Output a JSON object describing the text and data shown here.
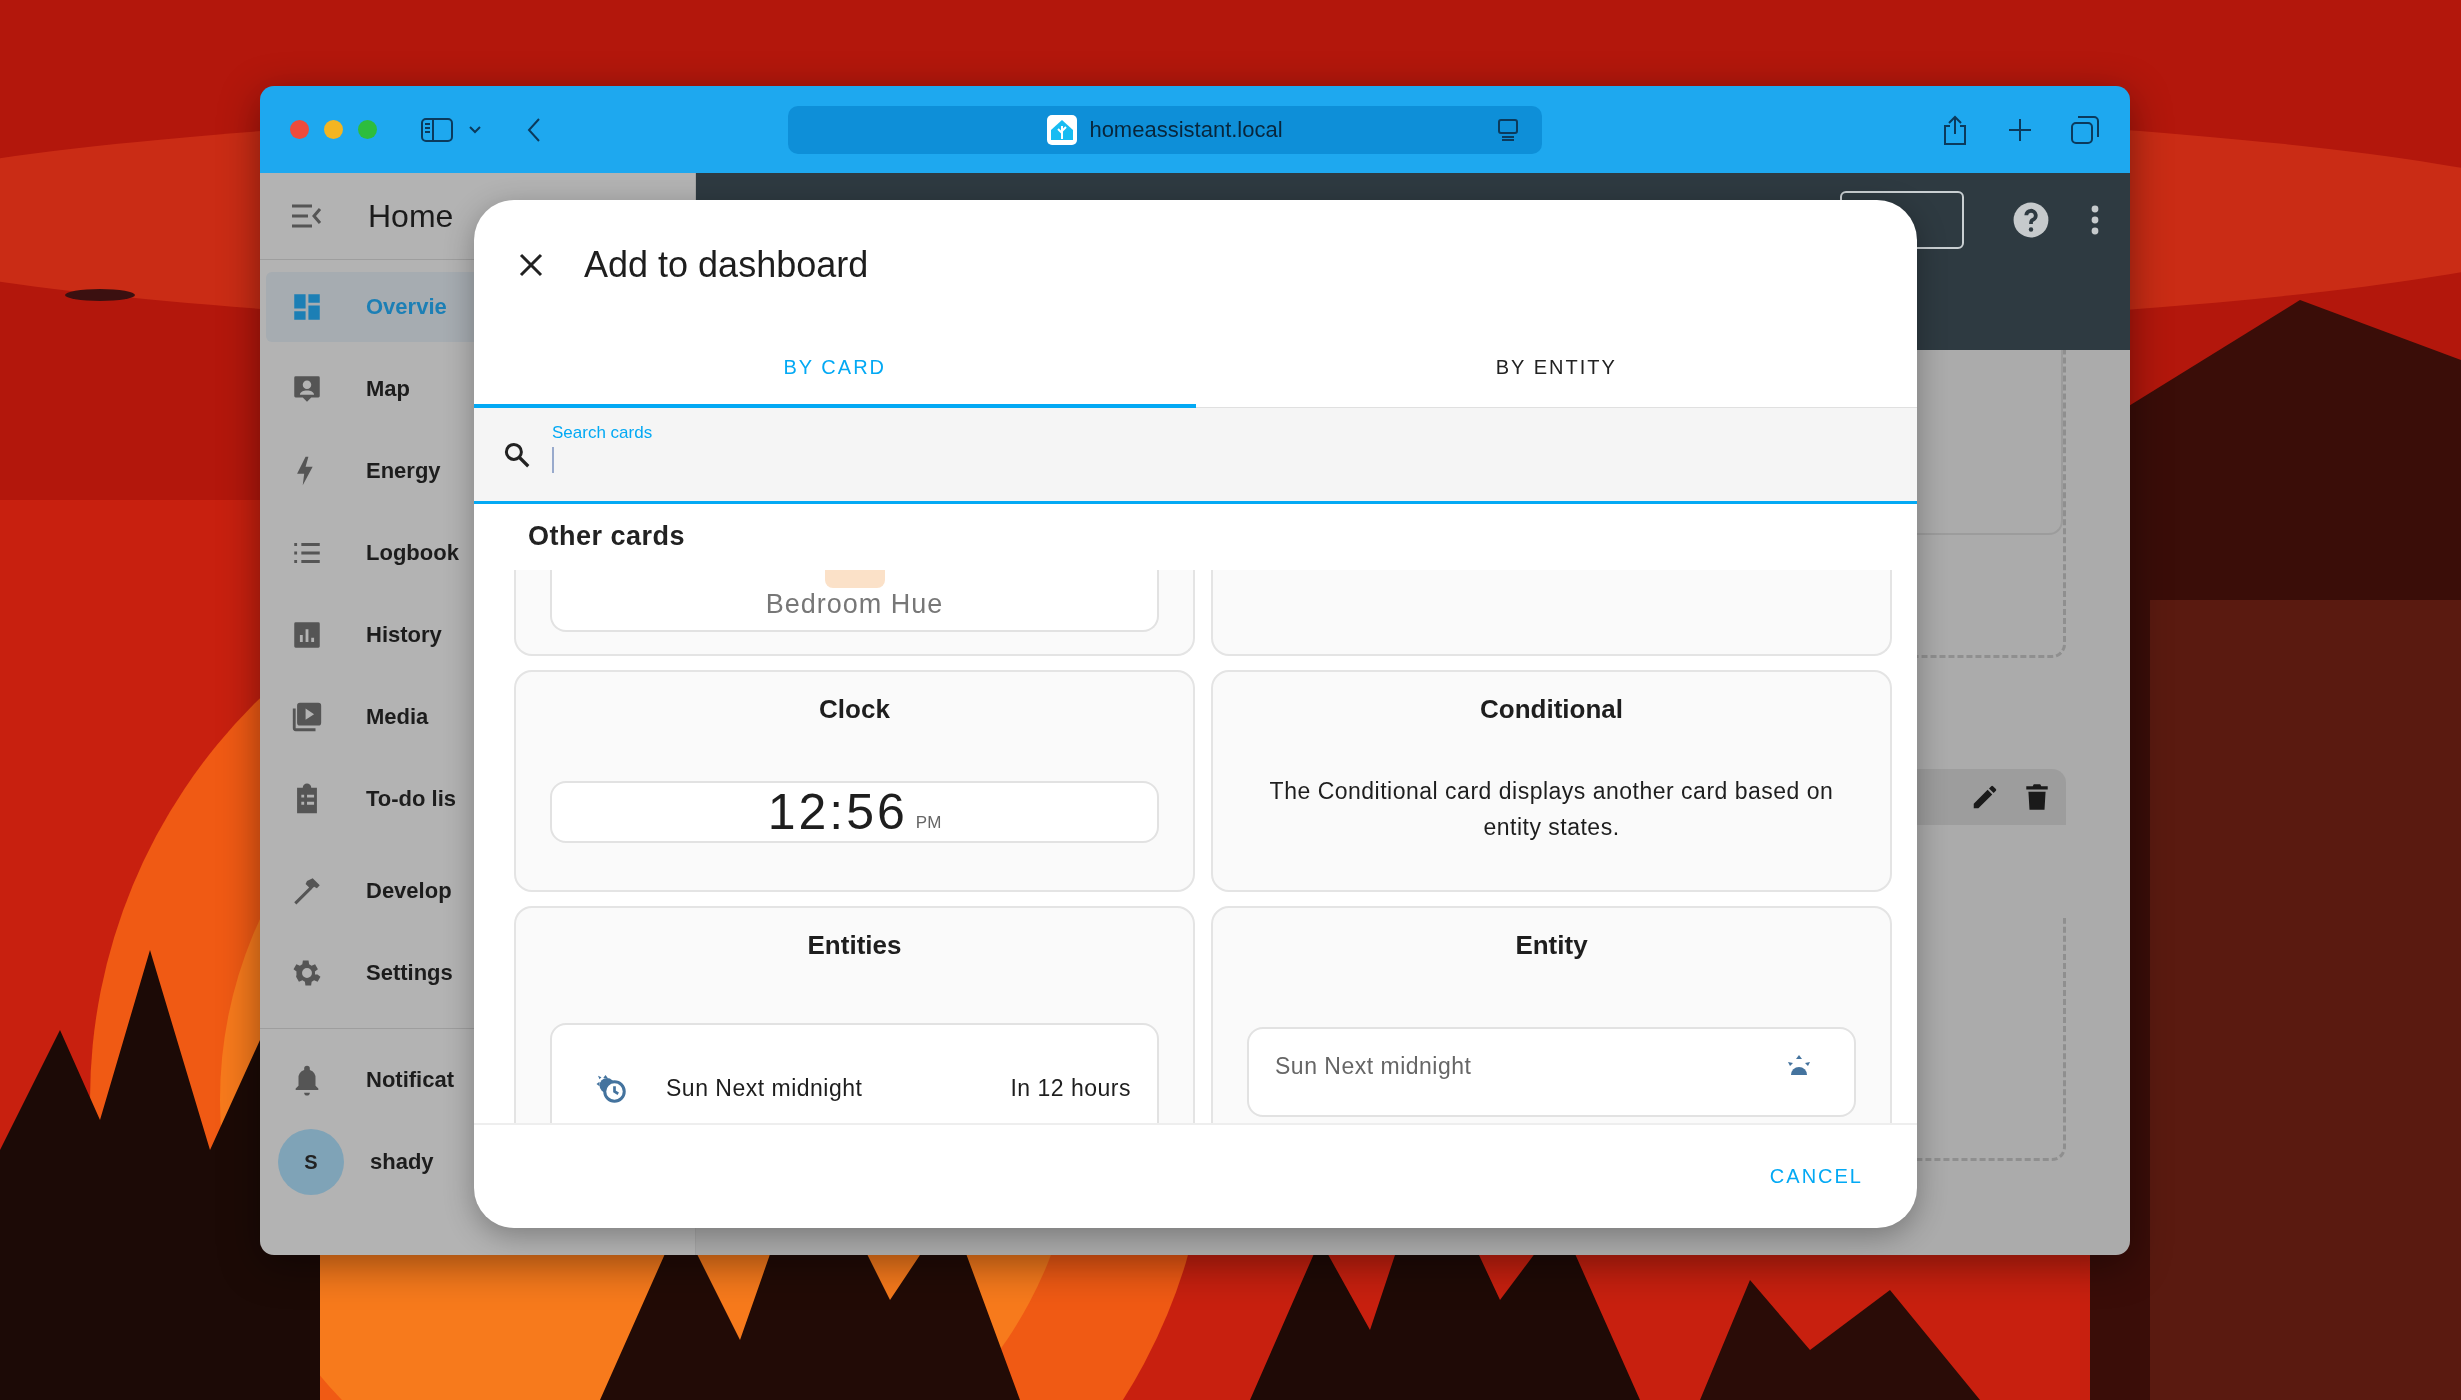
{
  "browser": {
    "url": "homeassistant.local"
  },
  "sidebar": {
    "title": "Home",
    "items": [
      {
        "label": "Overvie",
        "selected": true
      },
      {
        "label": "Map",
        "selected": false
      },
      {
        "label": "Energy",
        "selected": false
      },
      {
        "label": "Logbook",
        "selected": false
      },
      {
        "label": "History",
        "selected": false
      },
      {
        "label": "Media",
        "selected": false
      },
      {
        "label": "To-do lis",
        "selected": false
      },
      {
        "label": "Develop",
        "selected": false
      },
      {
        "label": "Settings",
        "selected": false
      }
    ],
    "notifications": "Notificat",
    "user": {
      "initial": "S",
      "name": "shady"
    }
  },
  "dialog": {
    "title": "Add to dashboard",
    "tabs": [
      {
        "label": "BY CARD",
        "selected": true
      },
      {
        "label": "BY ENTITY",
        "selected": false
      }
    ],
    "search": {
      "label": "Search cards"
    },
    "section_title": "Other cards",
    "cards": [
      {
        "kind": "light",
        "name": "Bedroom Hue"
      },
      {
        "kind": "blank"
      },
      {
        "kind": "clock",
        "title": "Clock",
        "time": "12:56",
        "period": "PM"
      },
      {
        "kind": "text",
        "title": "Conditional",
        "description": "The Conditional card displays another card based on entity states."
      },
      {
        "kind": "entities",
        "title": "Entities",
        "entity": "Sun Next midnight",
        "state": "In 12 hours"
      },
      {
        "kind": "entity",
        "title": "Entity",
        "entity": "Sun Next midnight"
      }
    ],
    "buttons": [
      "CANCEL"
    ]
  }
}
